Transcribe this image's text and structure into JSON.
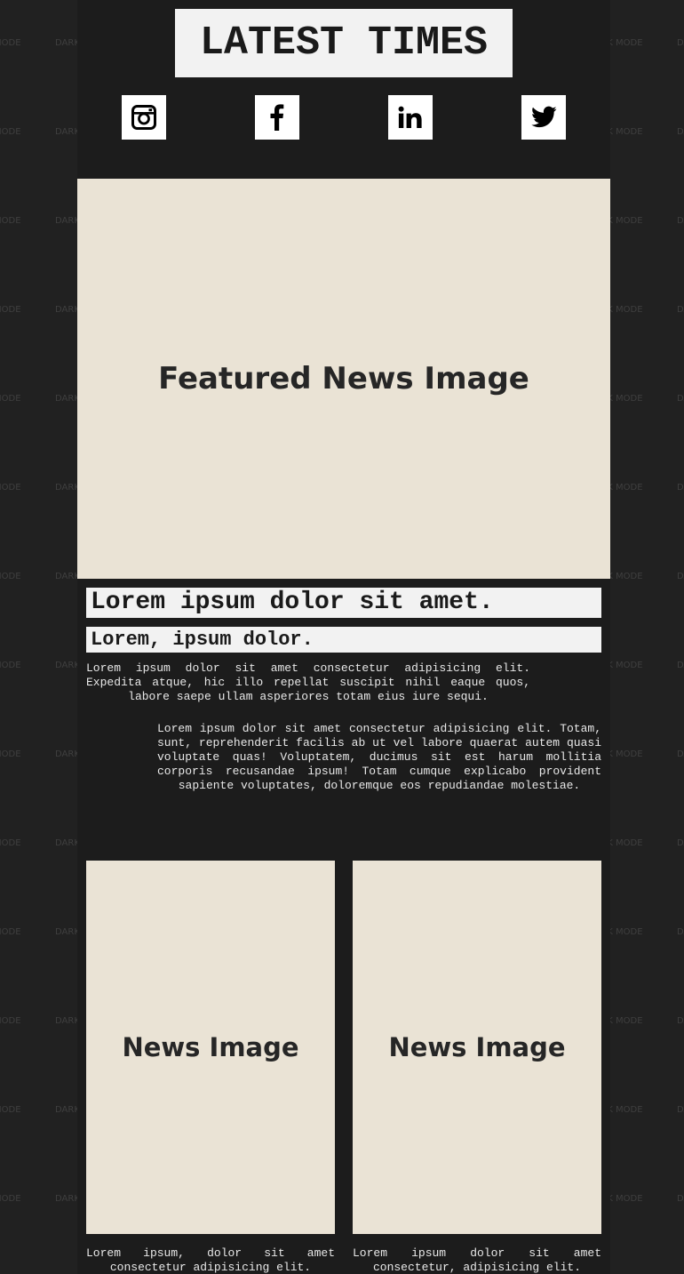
{
  "background": {
    "watermark_text": "DARK MODE",
    "page_color": "#212121",
    "column_color": "#1c1c1c"
  },
  "header": {
    "title": "LATEST TIMES"
  },
  "social": [
    {
      "name": "instagram",
      "icon": "instagram-icon"
    },
    {
      "name": "facebook",
      "icon": "facebook-icon"
    },
    {
      "name": "linkedin",
      "icon": "linkedin-icon"
    },
    {
      "name": "twitter",
      "icon": "twitter-icon"
    }
  ],
  "featured": {
    "image_label": "Featured News Image",
    "headline": "Lorem ipsum dolor sit amet.",
    "subheadline": "Lorem, ipsum dolor.",
    "intro": "Lorem ipsum dolor sit amet consectetur adipisicing elit. Expedita atque, hic illo repellat suscipit nihil eaque quos, labore saepe ullam asperiores totam eius iure sequi.",
    "body": "Lorem ipsum dolor sit amet consectetur adipisicing elit. Totam, sunt, reprehenderit facilis ab ut vel labore quaerat autem quasi voluptate quas! Voluptatem, ducimus sit est harum mollitia corporis recusandae ipsum! Totam cumque explicabo provident sapiente voluptates, doloremque eos repudiandae molestiae."
  },
  "cards": [
    {
      "image_label": "News Image",
      "text": "Lorem ipsum, dolor sit amet consectetur adipisicing elit."
    },
    {
      "image_label": "News Image",
      "text": "Lorem ipsum dolor sit amet consectetur, adipisicing elit."
    }
  ],
  "colors": {
    "placeholder": "#eae3d5",
    "headline_bg": "#f2f2f2",
    "text": "#e8e8e8"
  }
}
